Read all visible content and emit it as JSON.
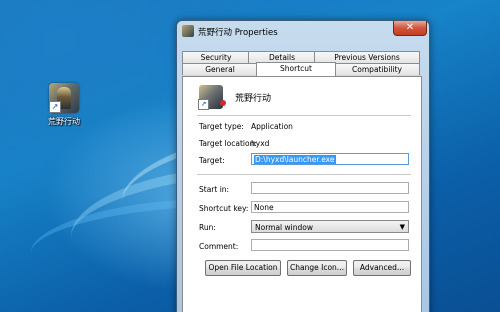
{
  "desktop": {
    "shortcut_label": "荒野行动"
  },
  "window": {
    "title": "荒野行动 Properties",
    "close_glyph": "✕",
    "tabs": [
      "Security",
      "Details",
      "Previous Versions",
      "General",
      "Shortcut",
      "Compatibility"
    ],
    "active_tab": "Shortcut"
  },
  "shortcut": {
    "name": "荒野行动",
    "target_type_label": "Target type:",
    "target_type": "Application",
    "target_location_label": "Target location:",
    "target_location": "hyxd",
    "target_label": "Target:",
    "target": "D:\\hyxd\\launcher.exe",
    "start_in_label": "Start in:",
    "start_in": "",
    "shortcut_key_label": "Shortcut key:",
    "shortcut_key": "None",
    "run_label": "Run:",
    "run": "Normal window",
    "comment_label": "Comment:",
    "comment": ""
  },
  "buttons": {
    "open_file_location": "Open File Location",
    "change_icon": "Change Icon...",
    "advanced": "Advanced..."
  },
  "icons": {
    "close": "close-icon",
    "shortcut_arrow": "shortcut-arrow-icon",
    "dropdown": "chevron-down-icon"
  }
}
